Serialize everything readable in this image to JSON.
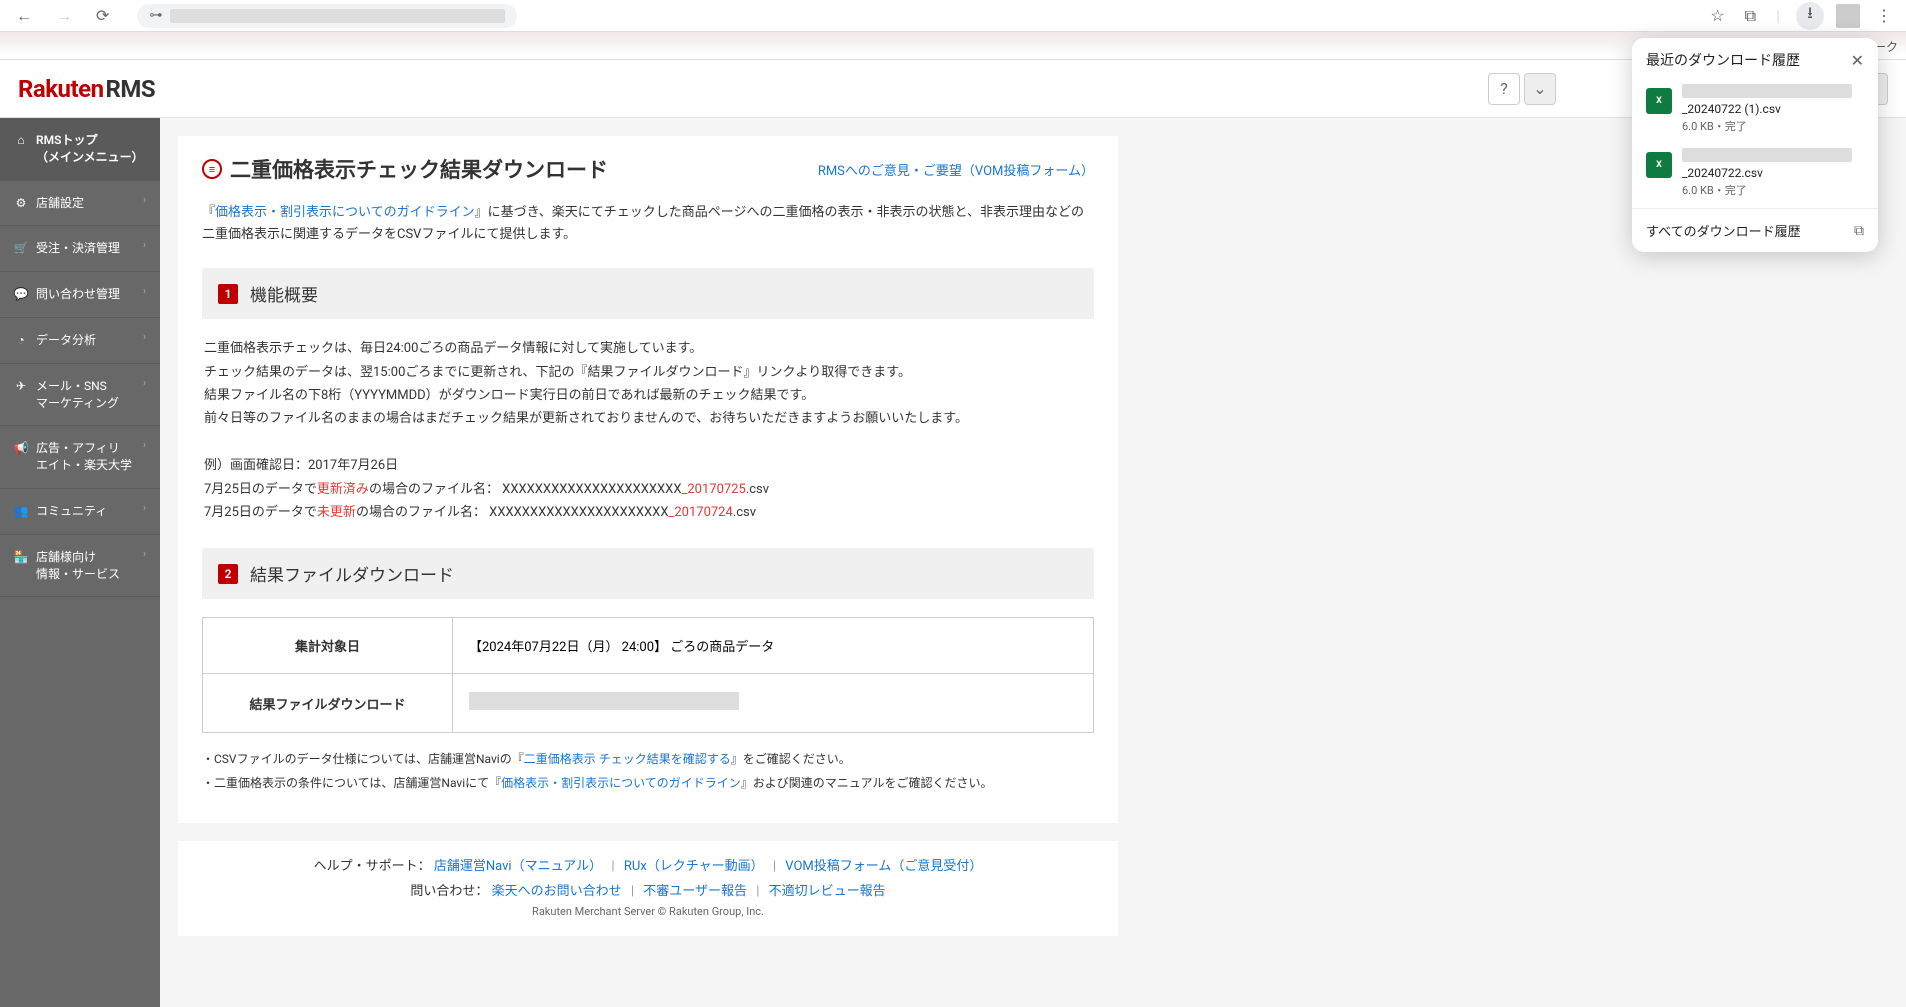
{
  "bookmarkBar": {
    "text": "ックマーク"
  },
  "header": {
    "logo": "Rakuten",
    "logoSuffix": "RMS"
  },
  "sidebar": {
    "items": [
      {
        "icon": "home",
        "label": "RMSトップ\n（メインメニュー）",
        "top": true
      },
      {
        "icon": "gear",
        "label": "店舗設定"
      },
      {
        "icon": "cart",
        "label": "受注・決済管理"
      },
      {
        "icon": "chat",
        "label": "問い合わせ管理"
      },
      {
        "icon": "chart",
        "label": "データ分析"
      },
      {
        "icon": "send",
        "label": "メール・SNS\nマーケティング"
      },
      {
        "icon": "megaphone",
        "label": "広告・アフィリ\nエイト・楽天大学"
      },
      {
        "icon": "users",
        "label": "コミュニティ"
      },
      {
        "icon": "store",
        "label": "店舗様向け\n情報・サービス"
      }
    ]
  },
  "page": {
    "title": "二重価格表示チェック結果ダウンロード",
    "feedbackLink": "RMSへのご意見・ご要望（VOM投稿フォーム）",
    "intro": {
      "prefix": "『",
      "link": "価格表示・割引表示についてのガイドライン",
      "suffix": "』に基づき、楽天にてチェックした商品ページへの二重価格の表示・非表示の状態と、非表示理由などの二重価格表示に関連するデータをCSVファイルにて提供します。"
    },
    "section1": {
      "number": "1",
      "title": "機能概要",
      "line1": "二重価格表示チェックは、毎日24:00ごろの商品データ情報に対して実施しています。",
      "line2": "チェック結果のデータは、翌15:00ごろまでに更新され、下記の『結果ファイルダウンロード』リンクより取得できます。",
      "line3": "結果ファイル名の下8桁（YYYYMMDD）がダウンロード実行日の前日であれば最新のチェック結果です。",
      "line4": "前々日等のファイル名のままの場合はまだチェック結果が更新されておりませんので、お待ちいただきますようお願いいたします。",
      "example": {
        "title": "例）画面確認日：2017年7月26日",
        "row1_prefix": "7月25日のデータで",
        "row1_status": "更新済み",
        "row1_suffix": "の場合のファイル名：  XXXXXXXXXXXXXXXXXXXXXX",
        "row1_dateSuffix": "_20170725",
        "row1_ext": ".csv",
        "row2_prefix": "7月25日のデータで",
        "row2_status": "未更新",
        "row2_suffix": "の場合のファイル名：  XXXXXXXXXXXXXXXXXXXXXX",
        "row2_dateSuffix": "_20170724",
        "row2_ext": ".csv"
      }
    },
    "section2": {
      "number": "2",
      "title": "結果ファイルダウンロード",
      "table": {
        "row1Label": "集計対象日",
        "row1Value": "【2024年07月22日（月） 24:00】 ごろの商品データ",
        "row2Label": "結果ファイルダウンロード"
      },
      "notes": {
        "n1_prefix": "・CSVファイルのデータ仕様については、店舗運営Naviの『",
        "n1_link": "二重価格表示 チェック結果を確認する",
        "n1_suffix": "』をご確認ください。",
        "n2_prefix": "・二重価格表示の条件については、店舗運営Naviにて『",
        "n2_link": "価格表示・割引表示についてのガイドライン",
        "n2_suffix": "』および関連のマニュアルをご確認ください。"
      }
    }
  },
  "footer": {
    "helpLabel": "ヘルプ・サポート：",
    "help1": "店舗運営Navi（マニュアル）",
    "help2": "RUx（レクチャー動画）",
    "help3": "VOM投稿フォーム（ご意見受付）",
    "contactLabel": "問い合わせ：",
    "contact1": "楽天へのお問い合わせ",
    "contact2": "不審ユーザー報告",
    "contact3": "不適切レビュー報告",
    "copyright": "Rakuten Merchant Server © Rakuten Group, Inc."
  },
  "downloadPopup": {
    "title": "最近のダウンロード履歴",
    "items": [
      {
        "name": "_20240722 (1).csv",
        "meta": "6.0 KB・完了"
      },
      {
        "name": "_20240722.csv",
        "meta": "6.0 KB・完了"
      }
    ],
    "footer": "すべてのダウンロード履歴"
  }
}
